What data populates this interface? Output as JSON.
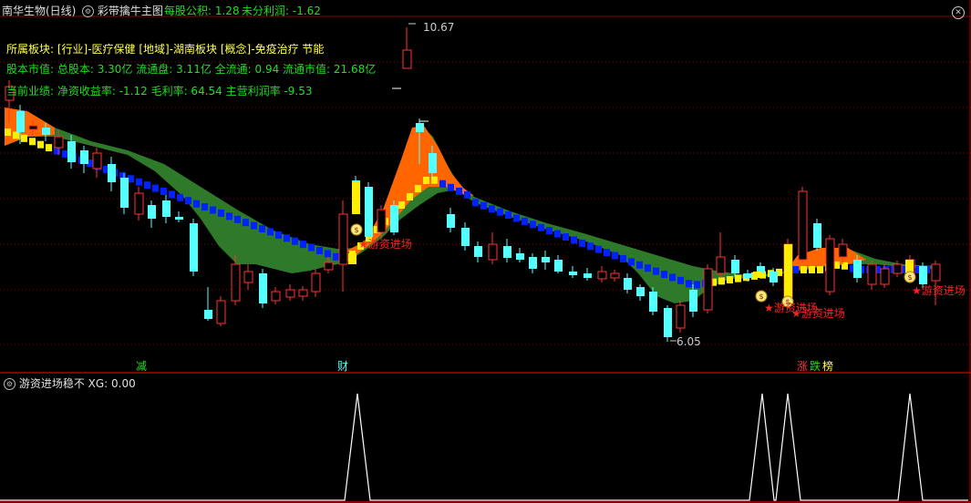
{
  "header": {
    "stock_name": "南华生物(日线)",
    "indicator_name": "彩带擒牛主图",
    "eps": "每股公积: 1.28",
    "undistributed": "未分利润: -1.62"
  },
  "info": {
    "sector_line": "所属板块: [行业]-医疗保健 [地域]-湖南板块 [概念]-免疫治疗 节能",
    "capital_line": "股本市值: 总股本: 3.30亿 流通盘: 3.11亿 全流通: 0.94 流通市值: 21.68亿",
    "performance_line": "当前业绩: 净资收益率: -1.12 毛利率: 64.54 主营利润率 -9.53"
  },
  "price_labels": {
    "high": "10.67",
    "low": "6.05"
  },
  "signal_labels": {
    "entry1": "★游资进场",
    "entry2": "★游资进场",
    "entry3": "★游资进场",
    "entry4": "★游资进场"
  },
  "day_marks": {
    "reduce": "减",
    "finance": "财",
    "rise": "涨",
    "fall": "跌",
    "list": "榜"
  },
  "sub_panel": {
    "title": "游资进场稳不 XG: 0.00"
  },
  "colors": {
    "up": "#ff3333",
    "down": "#54ffff",
    "ribbon_bull": "#ff6600",
    "ribbon_bear": "#2f7a2a",
    "ma_yellow": "#ffee00",
    "ma_blue": "#0022ff",
    "grid": "#8b0000"
  }
}
